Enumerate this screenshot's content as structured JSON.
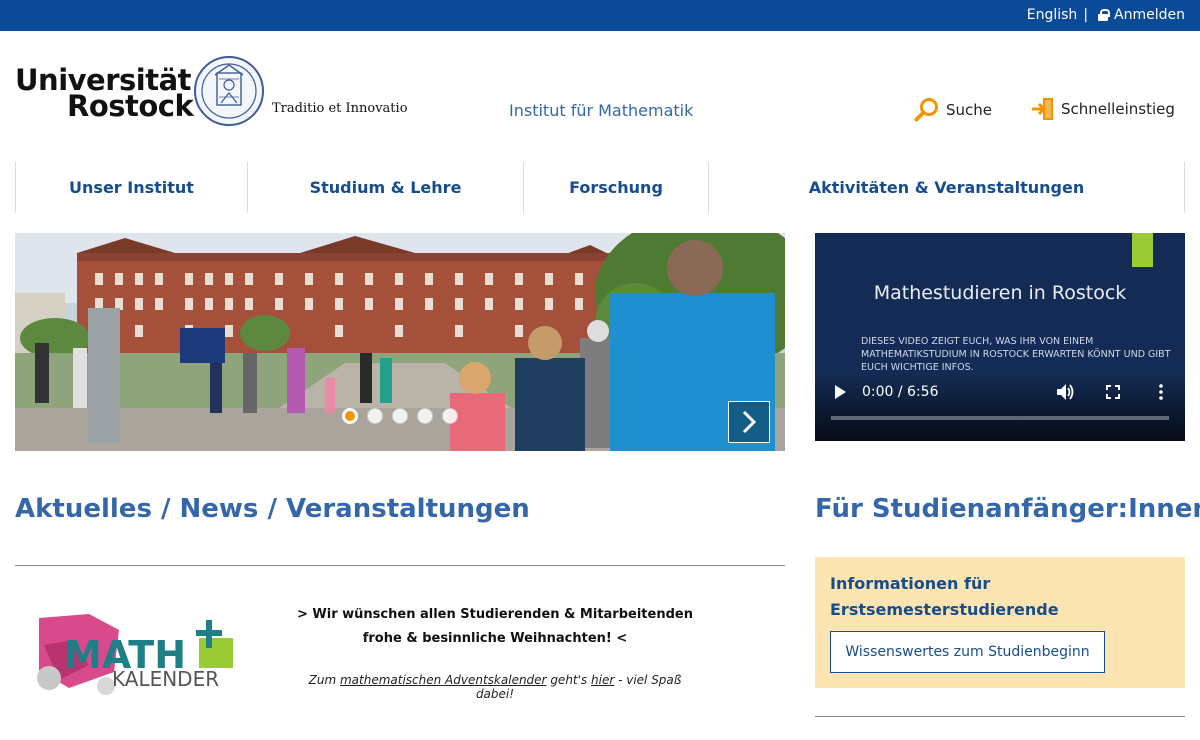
{
  "topbar": {
    "language": "English",
    "separator": "|",
    "login": "Anmelden"
  },
  "logo": {
    "line1": "Universität",
    "line2": "Rostock",
    "tagline": "Traditio et Innovatio"
  },
  "header": {
    "institute": "Institut für Mathematik",
    "search_label": "Suche",
    "quick_access_label": "Schnelleinstieg"
  },
  "nav": {
    "items": [
      {
        "label": "Unser Institut"
      },
      {
        "label": "Studium & Lehre"
      },
      {
        "label": "Forschung"
      },
      {
        "label": "Aktivitäten & Veranstaltungen"
      }
    ]
  },
  "slider": {
    "slide_count": 5,
    "active_index": 0
  },
  "video": {
    "title": "Mathestudieren in Rostock",
    "subtitle": "Dieses Video zeigt euch, was ihr von einem Mathematikstudium in Rostock erwarten könnt und gibt euch wichtige Infos.",
    "time": "0:00 / 6:56"
  },
  "news": {
    "title": "Aktuelles / News / Veranstaltungen",
    "math_logo": {
      "top": "MATH",
      "bottom": "KALENDER"
    },
    "greeting_line1": "> Wir wünschen allen Studierenden & Mitarbeitenden",
    "greeting_line2": "frohe & besinnliche Weihnachten! <",
    "advent_prefix": "Zum ",
    "advent_link": "mathematischen Adventskalender",
    "advent_middle": " geht's ",
    "advent_here": "hier",
    "advent_suffix": " - viel Spaß dabei!"
  },
  "freshmen": {
    "title": "Für Studienanfänger:Innen",
    "box_title": "Informationen für Erstsemesterstudierende",
    "button": "Wissenswertes zum Studienbeginn"
  },
  "colors": {
    "brand_blue": "#0a4a99",
    "link_blue": "#3567a8",
    "nav_blue": "#174c8d",
    "accent_orange": "#f29400",
    "info_bg": "#fde4b3"
  }
}
